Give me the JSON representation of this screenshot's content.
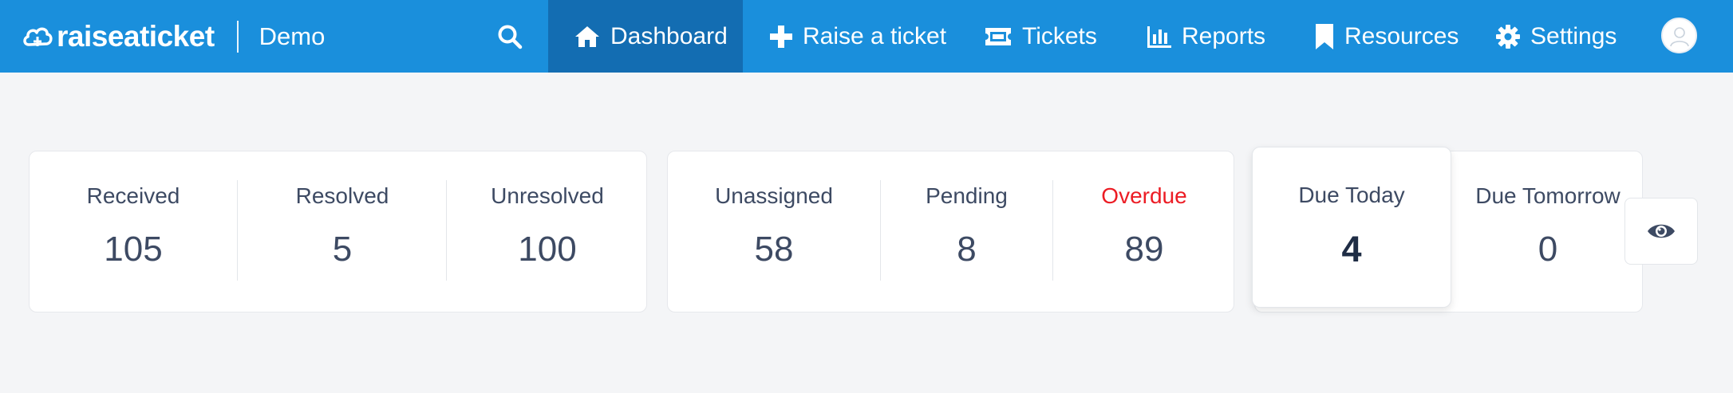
{
  "brand": {
    "name": "raiseaticket",
    "org": "Demo"
  },
  "nav": {
    "items": [
      {
        "label": "Dashboard",
        "icon": "home-icon",
        "active": true
      },
      {
        "label": "Raise a ticket",
        "icon": "plus-icon"
      },
      {
        "label": "Tickets",
        "icon": "ticket-icon"
      },
      {
        "label": "Reports",
        "icon": "bar-chart-icon"
      },
      {
        "label": "Resources",
        "icon": "bookmark-icon"
      },
      {
        "label": "Settings",
        "icon": "gear-icon"
      }
    ]
  },
  "stats": {
    "group1": [
      {
        "label": "Received",
        "value": "105"
      },
      {
        "label": "Resolved",
        "value": "5"
      },
      {
        "label": "Unresolved",
        "value": "100"
      }
    ],
    "group2": [
      {
        "label": "Unassigned",
        "value": "58"
      },
      {
        "label": "Pending",
        "value": "8"
      },
      {
        "label": "Overdue",
        "value": "89"
      }
    ],
    "due_today": {
      "label": "Due Today",
      "value": "4"
    },
    "due_tomorrow": {
      "label": "Due Tomorrow",
      "value": "0"
    }
  },
  "colors": {
    "header": "#1a8fdc",
    "active_nav": "#136db2",
    "overdue": "#ec1c24",
    "background": "#f4f5f7"
  }
}
